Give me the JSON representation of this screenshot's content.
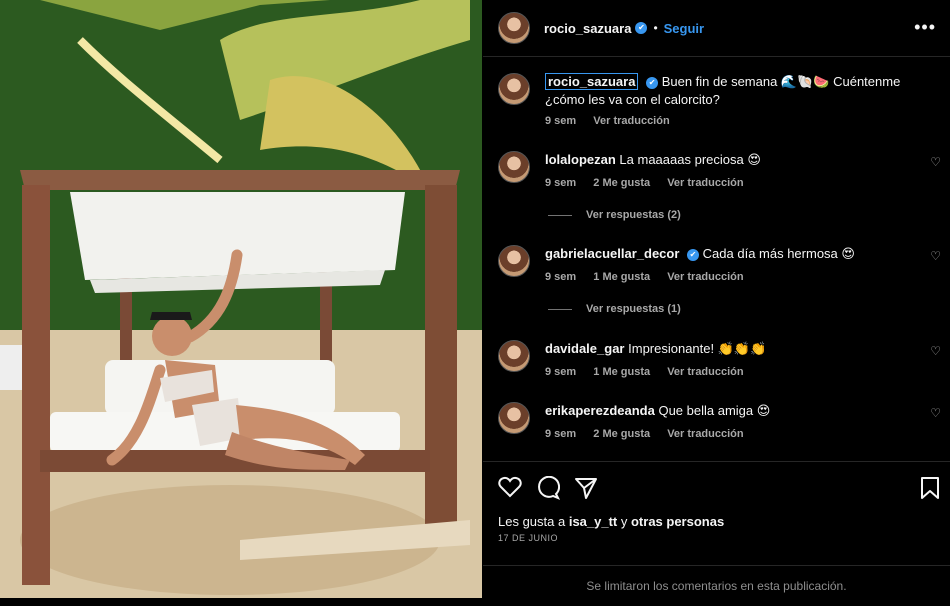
{
  "post_author": {
    "username": "rocio_sazuara",
    "verified": "✔",
    "follow_label": "Seguir",
    "more_label": "•••"
  },
  "caption": {
    "username": "rocio_sazuara",
    "text": "Buen fin de semana 🌊🐚🍉 Cuéntenme ¿cómo les va con el calorcito?",
    "time": "9 sem",
    "translate": "Ver traducción"
  },
  "comments": [
    {
      "username": "lolalopezan",
      "text": "La maaaaas preciosa 😍",
      "time": "9 sem",
      "likes": "2 Me gusta",
      "translate": "Ver traducción",
      "replies": "Ver respuestas (2)"
    },
    {
      "username": "gabrielacuellar_decor",
      "verified": "✔",
      "text": "Cada día más hermosa 😍",
      "time": "9 sem",
      "likes": "1 Me gusta",
      "translate": "Ver traducción",
      "replies": "Ver respuestas (1)"
    },
    {
      "username": "davidale_gar",
      "text": "Impresionante! 👏👏👏",
      "time": "9 sem",
      "likes": "1 Me gusta",
      "translate": "Ver traducción"
    },
    {
      "username": "erikaperezdeanda",
      "text": "Que bella amiga 😍",
      "time": "9 sem",
      "likes": "2 Me gusta",
      "translate": "Ver traducción"
    }
  ],
  "likes": {
    "prefix": "Les gusta a ",
    "user": "isa_y_tt",
    "middle": " y ",
    "others": "otras personas"
  },
  "date": "17 DE JUNIO",
  "comments_limited": "Se limitaron los comentarios en esta publicación.",
  "colors": {
    "background": "#000000",
    "link": "#3897f0",
    "muted": "#a8a8a8"
  },
  "icons": [
    "heart-icon",
    "comment-icon",
    "share-icon",
    "bookmark-icon",
    "more-icon"
  ]
}
